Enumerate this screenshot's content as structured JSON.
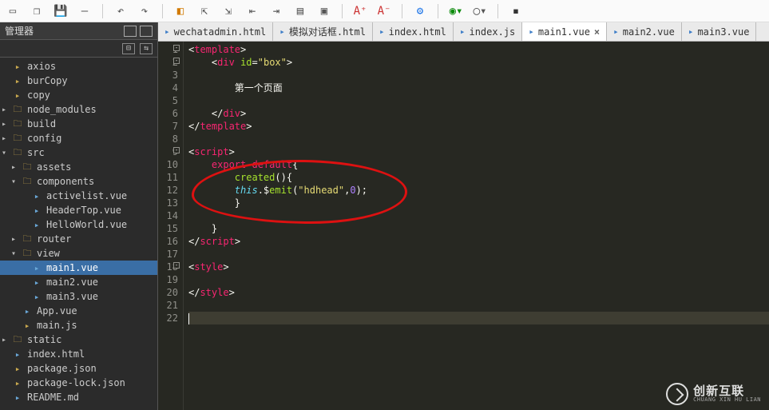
{
  "toolbar": {
    "icons": [
      "page",
      "dup",
      "save",
      "line",
      "undo",
      "redo",
      "bookmark",
      "arrow-up",
      "arrow-dn",
      "step-l",
      "step-r",
      "layout",
      "window",
      "font-inc",
      "font-dec",
      "gear",
      "circle",
      "chrome",
      "square"
    ]
  },
  "left": {
    "title": "管理器",
    "tree": [
      {
        "indent": 0,
        "arrow": "",
        "icon": "js",
        "label": "axios"
      },
      {
        "indent": 0,
        "arrow": "",
        "icon": "js",
        "label": "burCopy"
      },
      {
        "indent": 0,
        "arrow": "",
        "icon": "js",
        "label": "copy"
      },
      {
        "indent": 0,
        "arrow": "▸",
        "icon": "folder",
        "label": "node_modules"
      },
      {
        "indent": 0,
        "arrow": "▸",
        "icon": "folder",
        "label": "build"
      },
      {
        "indent": 0,
        "arrow": "▸",
        "icon": "folder",
        "label": "config"
      },
      {
        "indent": 0,
        "arrow": "▾",
        "icon": "folder-o",
        "label": "src"
      },
      {
        "indent": 1,
        "arrow": "▸",
        "icon": "folder",
        "label": "assets"
      },
      {
        "indent": 1,
        "arrow": "▾",
        "icon": "folder-o",
        "label": "components"
      },
      {
        "indent": 2,
        "arrow": "",
        "icon": "vue",
        "label": "activelist.vue"
      },
      {
        "indent": 2,
        "arrow": "",
        "icon": "vue",
        "label": "HeaderTop.vue"
      },
      {
        "indent": 2,
        "arrow": "",
        "icon": "vue",
        "label": "HelloWorld.vue"
      },
      {
        "indent": 1,
        "arrow": "▸",
        "icon": "folder",
        "label": "router"
      },
      {
        "indent": 1,
        "arrow": "▾",
        "icon": "folder-o",
        "label": "view"
      },
      {
        "indent": 2,
        "arrow": "",
        "icon": "vue",
        "label": "main1.vue",
        "selected": true
      },
      {
        "indent": 2,
        "arrow": "",
        "icon": "vue",
        "label": "main2.vue"
      },
      {
        "indent": 2,
        "arrow": "",
        "icon": "vue",
        "label": "main3.vue"
      },
      {
        "indent": 1,
        "arrow": "",
        "icon": "vue",
        "label": "App.vue"
      },
      {
        "indent": 1,
        "arrow": "",
        "icon": "js",
        "label": "main.js"
      },
      {
        "indent": 0,
        "arrow": "▸",
        "icon": "folder",
        "label": "static"
      },
      {
        "indent": 0,
        "arrow": "",
        "icon": "file",
        "label": "index.html"
      },
      {
        "indent": 0,
        "arrow": "",
        "icon": "js",
        "label": "package.json"
      },
      {
        "indent": 0,
        "arrow": "",
        "icon": "js",
        "label": "package-lock.json"
      },
      {
        "indent": 0,
        "arrow": "",
        "icon": "file",
        "label": "README.md"
      }
    ]
  },
  "tabs": [
    {
      "label": "wechatadmin.html",
      "active": false,
      "close": false
    },
    {
      "label": "模拟对话框.html",
      "active": false,
      "close": false
    },
    {
      "label": "index.html",
      "active": false,
      "close": false
    },
    {
      "label": "index.js",
      "active": false,
      "close": false
    },
    {
      "label": "main1.vue",
      "active": true,
      "close": true
    },
    {
      "label": "main2.vue",
      "active": false,
      "close": false
    },
    {
      "label": "main3.vue",
      "active": false,
      "close": false
    }
  ],
  "code": {
    "lines": [
      {
        "n": 1,
        "fold": true,
        "html": "<span class='tok-punct'>&lt;</span><span class='tok-tag'>template</span><span class='tok-punct'>&gt;</span>"
      },
      {
        "n": 2,
        "fold": true,
        "html": "    <span class='tok-punct'>&lt;</span><span class='tok-tag'>div</span> <span class='tok-attr'>id</span><span class='tok-punct'>=</span><span class='tok-str'>\"box\"</span><span class='tok-punct'>&gt;</span>"
      },
      {
        "n": 3,
        "html": ""
      },
      {
        "n": 4,
        "html": "        <span class='tok-text'>第一个页面</span>"
      },
      {
        "n": 5,
        "html": ""
      },
      {
        "n": 6,
        "html": "    <span class='tok-punct'>&lt;/</span><span class='tok-tag'>div</span><span class='tok-punct'>&gt;</span>"
      },
      {
        "n": 7,
        "html": "<span class='tok-punct'>&lt;/</span><span class='tok-tag'>template</span><span class='tok-punct'>&gt;</span>"
      },
      {
        "n": 8,
        "html": ""
      },
      {
        "n": 9,
        "fold": true,
        "html": "<span class='tok-punct'>&lt;</span><span class='tok-tag'>script</span><span class='tok-punct'>&gt;</span>"
      },
      {
        "n": 10,
        "html": "    <span class='tok-pink'>export default</span><span class='tok-punct'>{</span>"
      },
      {
        "n": 11,
        "html": "        <span class='tok-name'>created</span><span class='tok-punct'>(){</span>"
      },
      {
        "n": 12,
        "html": "        <span class='tok-sky'>this</span><span class='tok-punct'>.$</span><span class='tok-name'>emit</span><span class='tok-punct'>(</span><span class='tok-str'>\"hdhead\"</span><span class='tok-punct'>,</span><span class='tok-num'>0</span><span class='tok-punct'>);</span>"
      },
      {
        "n": 13,
        "html": "        <span class='tok-punct'>}</span>"
      },
      {
        "n": 14,
        "html": ""
      },
      {
        "n": 15,
        "html": "    <span class='tok-punct'>}</span>"
      },
      {
        "n": 16,
        "html": "<span class='tok-punct'>&lt;/</span><span class='tok-tag'>script</span><span class='tok-punct'>&gt;</span>"
      },
      {
        "n": 17,
        "html": ""
      },
      {
        "n": 18,
        "fold": true,
        "html": "<span class='tok-punct'>&lt;</span><span class='tok-tag'>style</span><span class='tok-punct'>&gt;</span>"
      },
      {
        "n": 19,
        "html": ""
      },
      {
        "n": 20,
        "html": "<span class='tok-punct'>&lt;/</span><span class='tok-tag'>style</span><span class='tok-punct'>&gt;</span>"
      },
      {
        "n": 21,
        "html": ""
      },
      {
        "n": 22,
        "html": "",
        "current": true
      }
    ]
  },
  "watermark": {
    "big": "创新互联",
    "small": "CHUANG XIN HU LIAN"
  }
}
